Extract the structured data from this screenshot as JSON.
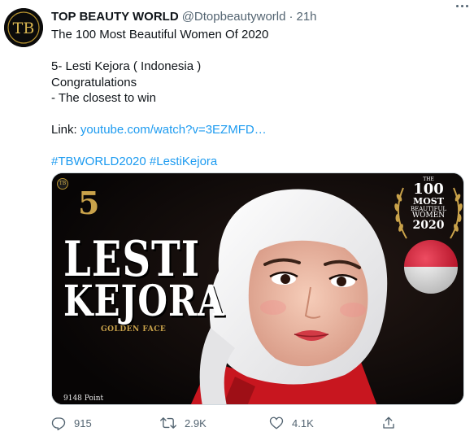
{
  "author": {
    "name": "TOP BEAUTY WORLD",
    "handle": "@Dtopbeautyworld",
    "separator": "·",
    "time": "21h",
    "avatar_text": "TB"
  },
  "tweet": {
    "line1": "The 100 Most Beautiful Women Of 2020",
    "line2": "5- Lesti Kejora ( Indonesia )",
    "line3": "Congratulations",
    "line4": "- The closest to win",
    "link_prefix": "Link: ",
    "link_text": "youtube.com/watch?v=3EZMFD…",
    "hashtags": "#TBWORLD2020 #LestiKejora"
  },
  "media": {
    "corner_badge": "TB",
    "rank": "5",
    "name_line1": "LESTI",
    "name_line2": "KEJORA",
    "subtitle": "GOLDEN FACE",
    "points": "9148 Point",
    "laurel": {
      "the": "THE",
      "hundred": "100",
      "most": "MOST",
      "beautiful": "BEAUTIFUL",
      "women": "WOMEN",
      "year": "2020"
    },
    "flag_colors": [
      "#e8112d",
      "#ffffff"
    ]
  },
  "actions": {
    "reply_count": "915",
    "retweet_count": "2.9K",
    "like_count": "4.1K",
    "icons": [
      "reply-icon",
      "retweet-icon",
      "like-icon",
      "share-icon"
    ]
  },
  "colors": {
    "link": "#1d9bf0",
    "secondary": "#536471",
    "gold": "#c9a24a"
  }
}
